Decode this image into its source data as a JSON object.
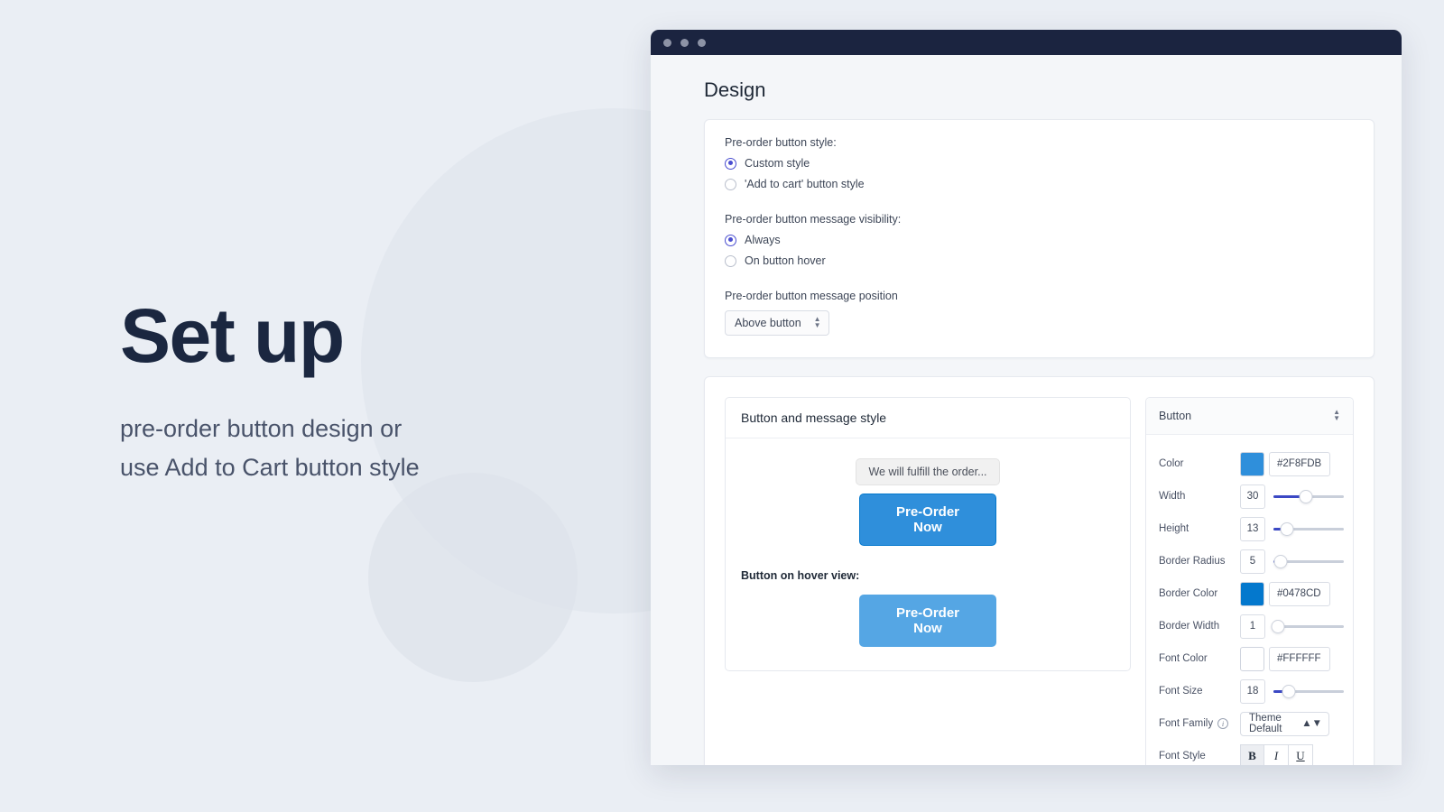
{
  "hero": {
    "title": "Set up",
    "subtitle_line1": "pre-order button design or",
    "subtitle_line2": "use Add to Cart button style"
  },
  "window": {
    "page_title": "Design"
  },
  "options_card": {
    "style_label": "Pre-order button style:",
    "style_options": [
      {
        "label": "Custom style",
        "selected": true
      },
      {
        "label": "'Add to cart' button style",
        "selected": false
      }
    ],
    "visibility_label": "Pre-order button message visibility:",
    "visibility_options": [
      {
        "label": "Always",
        "selected": true
      },
      {
        "label": "On button hover",
        "selected": false
      }
    ],
    "position_label": "Pre-order button message position",
    "position_value": "Above button"
  },
  "preview": {
    "heading": "Button and message style",
    "message_bubble": "We will fulfill the order...",
    "button_label": "Pre-Order Now",
    "hover_label": "Button on hover view:",
    "hover_button_label": "Pre-Order Now",
    "button_color": "#2F8FDB",
    "button_hover_color": "#55A6E4",
    "button_border_color": "#0478CD"
  },
  "style_panel": {
    "title": "Button",
    "rows": [
      {
        "label": "Color",
        "type": "color",
        "swatch": "#2F8FDB",
        "value": "#2F8FDB"
      },
      {
        "label": "Width",
        "type": "slider",
        "value": "30",
        "percent": 46
      },
      {
        "label": "Height",
        "type": "slider",
        "value": "13",
        "percent": 19
      },
      {
        "label": "Border Radius",
        "type": "slider",
        "value": "5",
        "percent": 10
      },
      {
        "label": "Border Color",
        "type": "color",
        "swatch": "#0478CD",
        "value": "#0478CD"
      },
      {
        "label": "Border Width",
        "type": "slider",
        "value": "1",
        "percent": 6
      },
      {
        "label": "Font Color",
        "type": "color",
        "swatch": "#FFFFFF",
        "value": "#FFFFFF"
      },
      {
        "label": "Font Size",
        "type": "slider",
        "value": "18",
        "percent": 22
      },
      {
        "label": "Font Family",
        "type": "select",
        "value": "Theme Default",
        "info": true
      },
      {
        "label": "Font Style",
        "type": "fontstyle"
      }
    ],
    "font_style_buttons": [
      {
        "label": "B",
        "active": true
      },
      {
        "label": "I",
        "active": false
      },
      {
        "label": "U",
        "active": false
      }
    ]
  }
}
